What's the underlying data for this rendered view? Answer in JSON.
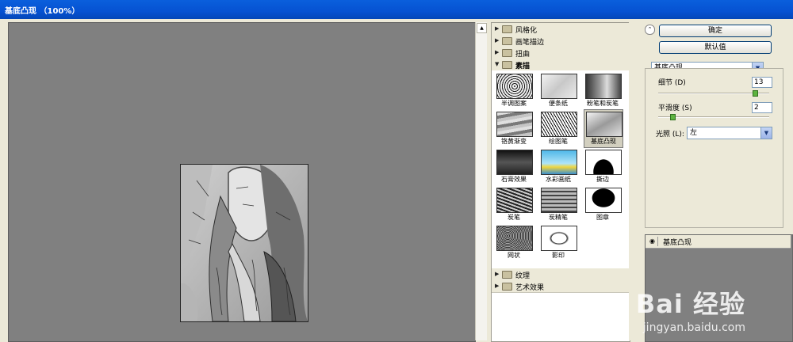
{
  "window": {
    "title": "基底凸现 （100%）"
  },
  "gallery": {
    "categories_top": [
      "风格化",
      "画笔描边",
      "扭曲"
    ],
    "open_category": "素描",
    "thumbs": [
      "半调图案",
      "便条纸",
      "粉笔和炭笔",
      "铬黄渐变",
      "绘图笔",
      "基底凸现",
      "石膏效果",
      "水彩画纸",
      "撕边",
      "炭笔",
      "炭精笔",
      "图章",
      "网状",
      "影印"
    ],
    "selected": "基底凸现",
    "categories_bottom": [
      "纹理",
      "艺术效果"
    ]
  },
  "panel": {
    "ok_label": "确定",
    "default_label": "默认值",
    "filter_select": "基底凸现",
    "detail_label": "细节 (D)",
    "detail_value": "13",
    "detail_level": 0.87,
    "smooth_label": "平滑度 (S)",
    "smooth_value": "2",
    "smooth_level": 0.13,
    "light_label": "光照 (L):",
    "light_value": "左",
    "layer_name": "基底凸现"
  },
  "watermark": {
    "brand": "Bai 经验",
    "url": "jingyan.baidu.com"
  },
  "colors": {
    "title_bar": "#0a5fdc",
    "preview_bg": "#808080",
    "panel_bg": "#ece9d8",
    "knob": "#5db340"
  },
  "icons": [
    "folder-icon",
    "triangle-right-icon",
    "triangle-down-icon",
    "eye-icon",
    "chevron-down-icon",
    "collapse-icon"
  ]
}
